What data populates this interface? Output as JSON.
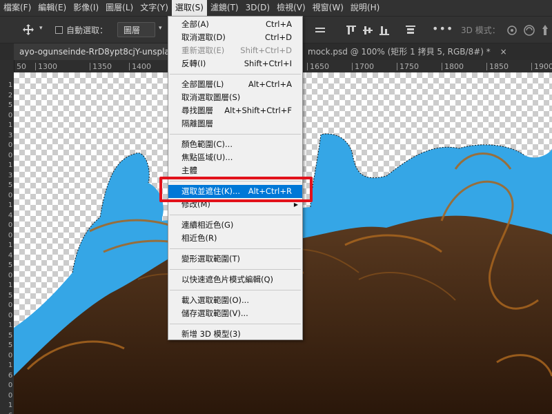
{
  "menubar": {
    "items": [
      {
        "label": "檔案(F)",
        "active": false
      },
      {
        "label": "編輯(E)",
        "active": false
      },
      {
        "label": "影像(I)",
        "active": false
      },
      {
        "label": "圖層(L)",
        "active": false
      },
      {
        "label": "文字(Y)",
        "active": false
      },
      {
        "label": "選取(S)",
        "active": true
      },
      {
        "label": "濾鏡(T)",
        "active": false
      },
      {
        "label": "3D(D)",
        "active": false
      },
      {
        "label": "檢視(V)",
        "active": false
      },
      {
        "label": "視窗(W)",
        "active": false
      },
      {
        "label": "說明(H)",
        "active": false
      }
    ]
  },
  "options": {
    "auto_select_label": "自動選取：",
    "layer_dropdown": "圖層",
    "threed_label": "3D 模式："
  },
  "tabs": [
    {
      "label": "ayo-ogunseinde-RrD8ypt8cjY-unsplash.jpg"
    },
    {
      "label": "mock.psd @ 100% (矩形 1 拷貝 5, RGB/8#) *",
      "close": "×"
    }
  ],
  "ruler": {
    "h_ticks": [
      "50",
      "1300",
      "1350",
      "1400",
      "1650",
      "1700",
      "1750",
      "1800",
      "1850",
      "1900"
    ],
    "v_numbers": [
      "1",
      "2",
      "5",
      "0",
      "1",
      "3",
      "0",
      "0",
      "1",
      "3",
      "5",
      "0",
      "1",
      "4",
      "0",
      "0",
      "1",
      "4",
      "5",
      "0",
      "1",
      "5",
      "0",
      "0",
      "1",
      "5",
      "5",
      "0",
      "1",
      "6",
      "0",
      "0",
      "1",
      "6",
      "5"
    ]
  },
  "menu": {
    "groups": [
      [
        {
          "label": "全部(A)",
          "shortcut": "Ctrl+A"
        },
        {
          "label": "取消選取(D)",
          "shortcut": "Ctrl+D"
        },
        {
          "label": "重新選取(E)",
          "shortcut": "Shift+Ctrl+D",
          "disabled": true
        },
        {
          "label": "反轉(I)",
          "shortcut": "Shift+Ctrl+I"
        }
      ],
      [
        {
          "label": "全部圖層(L)",
          "shortcut": "Alt+Ctrl+A"
        },
        {
          "label": "取消選取圖層(S)",
          "shortcut": ""
        },
        {
          "label": "尋找圖層",
          "shortcut": "Alt+Shift+Ctrl+F"
        },
        {
          "label": "隔離圖層",
          "shortcut": ""
        }
      ],
      [
        {
          "label": "顏色範圍(C)...",
          "shortcut": ""
        },
        {
          "label": "焦點區域(U)...",
          "shortcut": ""
        },
        {
          "label": "主體",
          "shortcut": ""
        }
      ],
      [
        {
          "label": "選取並遮住(K)...",
          "shortcut": "Alt+Ctrl+R",
          "highlighted": true
        },
        {
          "label": "修改(M)",
          "shortcut": "",
          "submenu": true
        }
      ],
      [
        {
          "label": "連續相近色(G)",
          "shortcut": ""
        },
        {
          "label": "相近色(R)",
          "shortcut": ""
        }
      ],
      [
        {
          "label": "變形選取範圍(T)",
          "shortcut": ""
        }
      ],
      [
        {
          "label": "以快速遮色片模式編輯(Q)",
          "shortcut": ""
        }
      ],
      [
        {
          "label": "載入選取範圍(O)...",
          "shortcut": ""
        },
        {
          "label": "儲存選取範圍(V)...",
          "shortcut": ""
        }
      ],
      [
        {
          "label": "新增 3D 模型(3)",
          "shortcut": ""
        }
      ]
    ]
  },
  "colors": {
    "selection_blue": "#35a6e6",
    "hair_dark": "#3b2414",
    "hair_light": "#a8651f",
    "menu_highlight": "#0078d7",
    "callout_red": "#e2121b"
  }
}
